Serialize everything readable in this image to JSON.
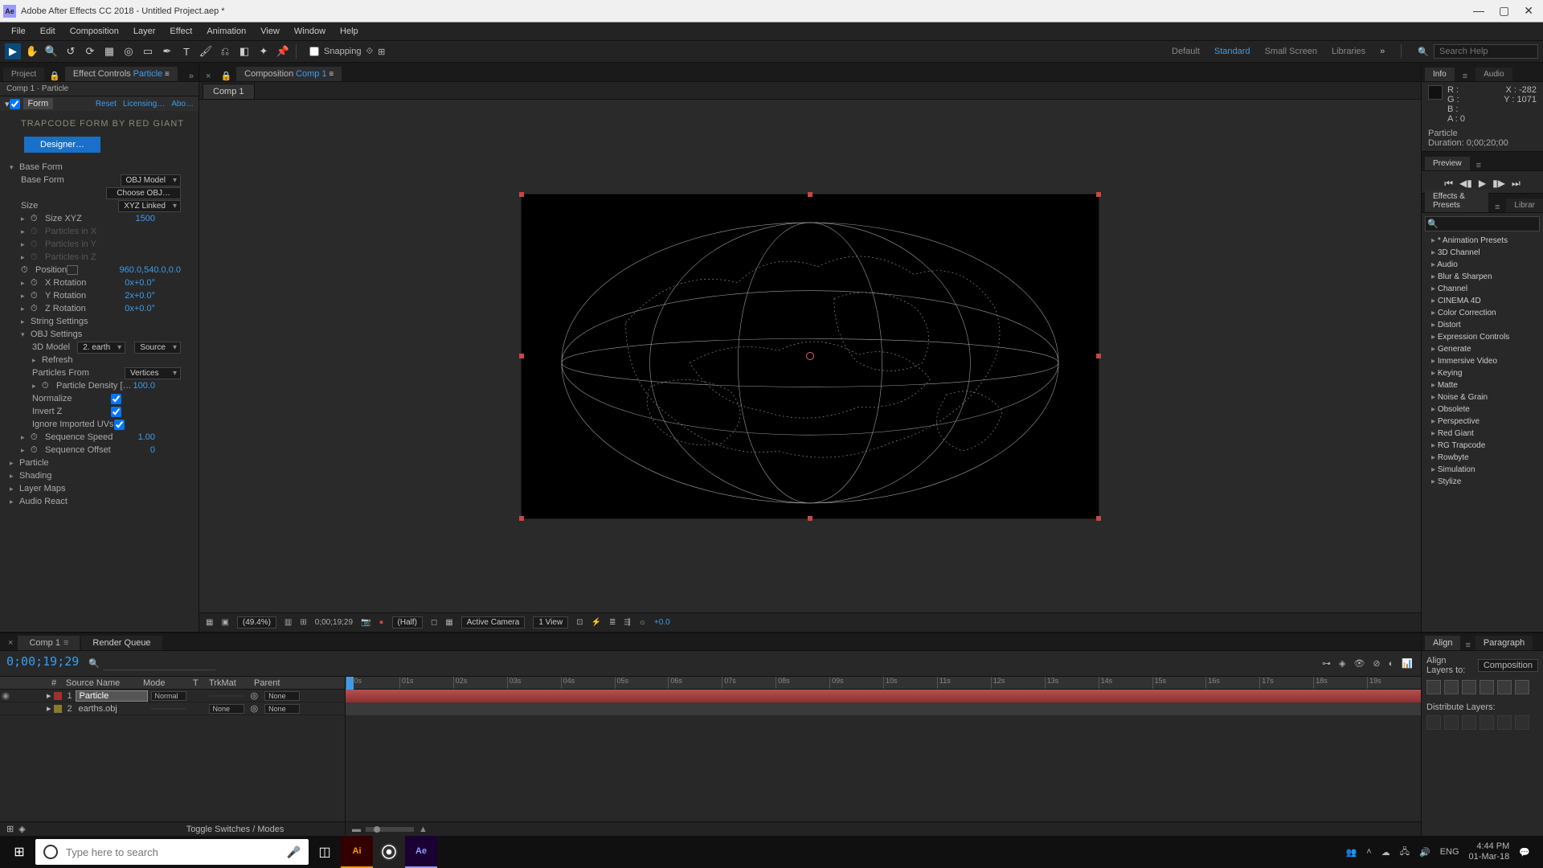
{
  "title": "Adobe After Effects CC 2018 - Untitled Project.aep *",
  "menu": [
    "File",
    "Edit",
    "Composition",
    "Layer",
    "Effect",
    "Animation",
    "View",
    "Window",
    "Help"
  ],
  "toolbar": {
    "snapping": "Snapping"
  },
  "workspaces": [
    "Default",
    "Standard",
    "Small Screen",
    "Libraries"
  ],
  "search_placeholder": "Search Help",
  "left": {
    "tabs": {
      "project": "Project",
      "effect_controls": "Effect Controls",
      "target": "Particle"
    },
    "subheader": "Comp 1 · Particle",
    "fx": {
      "name": "Form",
      "links": {
        "reset": "Reset",
        "licensing": "Licensing…",
        "about": "Abo…"
      },
      "title": "TRAPCODE FORM BY RED GIANT",
      "designer": "Designer…",
      "groups": {
        "base_form": "Base Form",
        "particle": "Particle",
        "shading": "Shading",
        "layer_maps": "Layer Maps",
        "audio_react": "Audio React"
      },
      "props": {
        "base_form_label": "Base Form",
        "base_form_value": "OBJ Model",
        "choose_obj": "Choose OBJ…",
        "size": "Size",
        "size_value": "XYZ Linked",
        "size_xyz": "Size XYZ",
        "size_xyz_val": "1500",
        "particles_x": "Particles in X",
        "particles_y": "Particles in Y",
        "particles_z": "Particles in Z",
        "position": "Position",
        "position_val": "960.0,540.0,0.0",
        "x_rot": "X Rotation",
        "x_rot_val": "0x+0.0°",
        "y_rot": "Y Rotation",
        "y_rot_val": "2x+0.0°",
        "z_rot": "Z Rotation",
        "z_rot_val": "0x+0.0°",
        "string_settings": "String Settings",
        "obj_settings": "OBJ Settings",
        "_3d_model": "3D Model",
        "_3d_model_val": "2. earth",
        "_3d_model_src": "Source",
        "refresh": "Refresh",
        "particles_from": "Particles From",
        "particles_from_val": "Vertices",
        "particle_density": "Particle Density […",
        "particle_density_val": "100.0",
        "normalize": "Normalize",
        "invert_z": "Invert Z",
        "ignore_uvs": "Ignore Imported UVs",
        "seq_speed": "Sequence Speed",
        "seq_speed_val": "1.00",
        "seq_offset": "Sequence Offset",
        "seq_offset_val": "0"
      }
    }
  },
  "center": {
    "tab_label": "Composition",
    "tab_target": "Comp 1",
    "comp_tab": "Comp 1",
    "viewer_bar": {
      "zoom": "(49.4%)",
      "timecode": "0;00;19;29",
      "res": "(Half)",
      "camera": "Active Camera",
      "view": "1 View",
      "exposure": "+0.0"
    }
  },
  "right": {
    "tabs": {
      "info": "Info",
      "audio": "Audio"
    },
    "info": {
      "r": "R :",
      "g": "G :",
      "b": "B :",
      "a": "A : 0",
      "x": "X : -282",
      "y": "Y : 1071",
      "layer": "Particle",
      "duration": "Duration: 0;00;20;00"
    },
    "preview": {
      "label": "Preview"
    },
    "ep": {
      "label": "Effects & Presets",
      "librar": "Librar",
      "items": [
        "* Animation Presets",
        "3D Channel",
        "Audio",
        "Blur & Sharpen",
        "Channel",
        "CINEMA 4D",
        "Color Correction",
        "Distort",
        "Expression Controls",
        "Generate",
        "Immersive Video",
        "Keying",
        "Matte",
        "Noise & Grain",
        "Obsolete",
        "Perspective",
        "Red Giant",
        "RG Trapcode",
        "Rowbyte",
        "Simulation",
        "Stylize"
      ]
    }
  },
  "timeline": {
    "tabs": {
      "comp": "Comp 1",
      "rq": "Render Queue"
    },
    "timecode": "0;00;19;29",
    "cols": {
      "source": "Source Name",
      "mode": "Mode",
      "trkmat": "TrkMat",
      "parent": "Parent"
    },
    "layers": [
      {
        "num": "1",
        "name": "Particle",
        "mode": "Normal",
        "trk": "",
        "parent": "None"
      },
      {
        "num": "2",
        "name": "earths.obj",
        "mode": "",
        "trk": "None",
        "parent": "None"
      }
    ],
    "ruler": [
      ":00s",
      "01s",
      "02s",
      "03s",
      "04s",
      "05s",
      "06s",
      "07s",
      "08s",
      "09s",
      "10s",
      "11s",
      "12s",
      "13s",
      "14s",
      "15s",
      "16s",
      "17s",
      "18s",
      "19s"
    ],
    "toggle": "Toggle Switches / Modes"
  },
  "align": {
    "tabs": {
      "align": "Align",
      "paragraph": "Paragraph"
    },
    "label": "Align Layers to:",
    "target": "Composition",
    "dist": "Distribute Layers:"
  },
  "taskbar": {
    "search_placeholder": "Type here to search",
    "time": "4:44 PM",
    "date": "01-Mar-18"
  }
}
